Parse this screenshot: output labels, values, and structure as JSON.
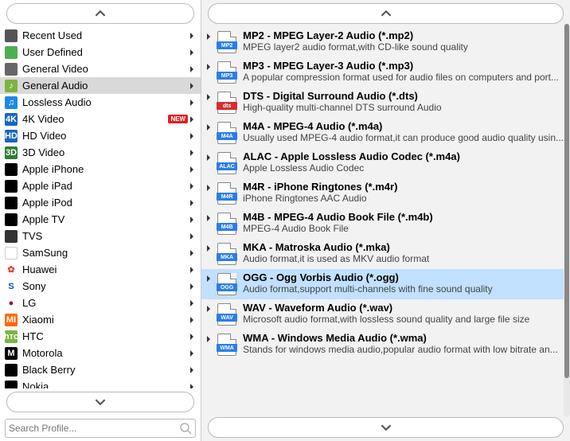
{
  "search": {
    "placeholder": "Search Profile..."
  },
  "categories": [
    {
      "label": "Recent Used",
      "icon_bg": "#555",
      "icon_txt": "",
      "icon_fg": "#fff"
    },
    {
      "label": "User Defined",
      "icon_bg": "#4caf50",
      "icon_txt": "",
      "icon_fg": "#fff"
    },
    {
      "label": "General Video",
      "icon_bg": "#666",
      "icon_txt": "",
      "icon_fg": "#fff"
    },
    {
      "label": "General Audio",
      "icon_bg": "#7cb342",
      "icon_txt": "♪",
      "icon_fg": "#fff",
      "selected": true
    },
    {
      "label": "Lossless Audio",
      "icon_bg": "#1e88e5",
      "icon_txt": "♫",
      "icon_fg": "#fff"
    },
    {
      "label": "4K Video",
      "icon_bg": "#1565c0",
      "icon_txt": "4K",
      "icon_fg": "#fff",
      "badge": "NEW"
    },
    {
      "label": "HD Video",
      "icon_bg": "#1565c0",
      "icon_txt": "HD",
      "icon_fg": "#fff"
    },
    {
      "label": "3D Video",
      "icon_bg": "#2e7d32",
      "icon_txt": "3D",
      "icon_fg": "#fff"
    },
    {
      "label": "Apple iPhone",
      "icon_bg": "#000",
      "icon_txt": "",
      "icon_fg": "#fff"
    },
    {
      "label": "Apple iPad",
      "icon_bg": "#000",
      "icon_txt": "",
      "icon_fg": "#fff"
    },
    {
      "label": "Apple iPod",
      "icon_bg": "#000",
      "icon_txt": "",
      "icon_fg": "#fff"
    },
    {
      "label": "Apple TV",
      "icon_bg": "#000",
      "icon_txt": "",
      "icon_fg": "#fff"
    },
    {
      "label": "TVS",
      "icon_bg": "#333",
      "icon_txt": "",
      "icon_fg": "#fff"
    },
    {
      "label": "SamSung",
      "icon_bg": "#fff",
      "icon_txt": "",
      "icon_fg": "#1428a0",
      "border": true
    },
    {
      "label": "Huawei",
      "icon_bg": "#fff",
      "icon_txt": "✿",
      "icon_fg": "#e53935"
    },
    {
      "label": "Sony",
      "icon_bg": "#fff",
      "icon_txt": "S",
      "icon_fg": "#0b4ea2"
    },
    {
      "label": "LG",
      "icon_bg": "#fff",
      "icon_txt": "●",
      "icon_fg": "#a50034"
    },
    {
      "label": "Xiaomi",
      "icon_bg": "#ff6900",
      "icon_txt": "MI",
      "icon_fg": "#fff"
    },
    {
      "label": "HTC",
      "icon_bg": "#7cb342",
      "icon_txt": "hтc",
      "icon_fg": "#fff"
    },
    {
      "label": "Motorola",
      "icon_bg": "#000",
      "icon_txt": "M",
      "icon_fg": "#fff"
    },
    {
      "label": "Black Berry",
      "icon_bg": "#000",
      "icon_txt": "",
      "icon_fg": "#fff"
    },
    {
      "label": "Nokia",
      "icon_bg": "#000",
      "icon_txt": "",
      "icon_fg": "#fff"
    }
  ],
  "formats": [
    {
      "title": "MP2 - MPEG Layer-2 Audio (*.mp2)",
      "desc": "MPEG layer2 audio format,with CD-like sound quality",
      "band": "MP2",
      "color": "#2b7de9"
    },
    {
      "title": "MP3 - MPEG Layer-3 Audio (*.mp3)",
      "desc": "A popular compression format used for audio files on computers and port...",
      "band": "MP3",
      "color": "#2b7de9"
    },
    {
      "title": "DTS - Digital Surround Audio (*.dts)",
      "desc": "High-quality multi-channel DTS surround Audio",
      "band": "dts",
      "color": "#d32f2f"
    },
    {
      "title": "M4A - MPEG-4 Audio (*.m4a)",
      "desc": "Usually used MPEG-4 audio format,it can produce good audio quality usin...",
      "band": "M4A",
      "color": "#2b7de9"
    },
    {
      "title": "ALAC - Apple Lossless Audio Codec (*.m4a)",
      "desc": "Apple Lossless Audio Codec",
      "band": "ALAC",
      "color": "#2b7de9"
    },
    {
      "title": "M4R - iPhone Ringtones (*.m4r)",
      "desc": "iPhone Ringtones AAC Audio",
      "band": "M4R",
      "color": "#2b7de9"
    },
    {
      "title": "M4B - MPEG-4 Audio Book File (*.m4b)",
      "desc": "MPEG-4 Audio Book File",
      "band": "M4B",
      "color": "#2b7de9"
    },
    {
      "title": "MKA - Matroska Audio (*.mka)",
      "desc": "Audio format,it is used as MKV audio format",
      "band": "MKA",
      "color": "#2b7de9"
    },
    {
      "title": "OGG - Ogg Vorbis Audio (*.ogg)",
      "desc": "Audio format,support multi-channels with fine sound quality",
      "band": "OGG",
      "color": "#2b7de9",
      "selected": true
    },
    {
      "title": "WAV - Waveform Audio (*.wav)",
      "desc": "Microsoft audio format,with lossless sound quality and large file size",
      "band": "WAV",
      "color": "#2b7de9"
    },
    {
      "title": "WMA - Windows Media Audio (*.wma)",
      "desc": "Stands for windows media audio,popular audio format with low bitrate an...",
      "band": "WMA",
      "color": "#2b7de9"
    }
  ]
}
